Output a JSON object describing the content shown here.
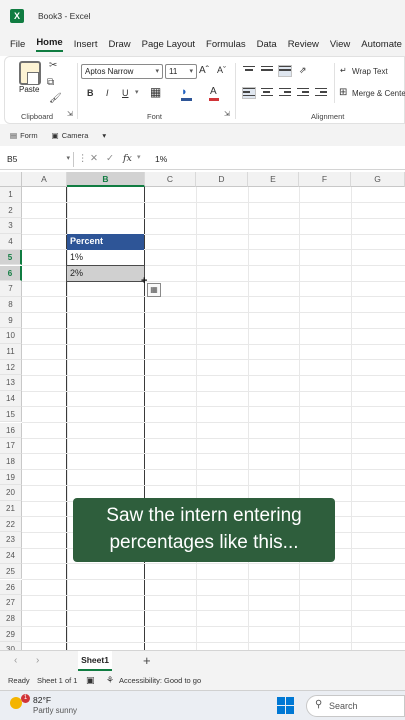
{
  "window": {
    "title": "Book3  -  Excel",
    "app_icon": "excel-logo-icon"
  },
  "menu": [
    "File",
    "Home",
    "Insert",
    "Draw",
    "Page Layout",
    "Formulas",
    "Data",
    "Review",
    "View",
    "Automate"
  ],
  "menu_active": "Home",
  "ribbon": {
    "clipboard": {
      "label": "Clipboard",
      "paste_label": "Paste"
    },
    "font": {
      "label": "Font",
      "family": "Aptos Narrow",
      "size": "11",
      "grow": "Aˆ",
      "shrink": "Aˇ",
      "bold": "B",
      "italic": "I",
      "underline": "U"
    },
    "alignment": {
      "label": "Alignment",
      "wrap_text": "Wrap Text",
      "merge_center": "Merge & Center"
    }
  },
  "qat": {
    "form": "Form",
    "camera": "Camera"
  },
  "formula_bar": {
    "name_box": "B5",
    "fx": "fx",
    "value": "1%"
  },
  "columns": [
    "A",
    "B",
    "C",
    "D",
    "E",
    "F",
    "G"
  ],
  "rows": [
    "1",
    "2",
    "3",
    "4",
    "5",
    "6",
    "7",
    "8",
    "9",
    "10",
    "11",
    "12",
    "13",
    "14",
    "15",
    "16",
    "17",
    "18",
    "19",
    "20",
    "21",
    "22",
    "23",
    "24",
    "25",
    "26",
    "27",
    "28",
    "29",
    "30"
  ],
  "cells": {
    "B4": "Percent",
    "B5": "1%",
    "B6": "2%"
  },
  "caption": {
    "line1": "Saw the intern entering",
    "line2": "percentages like this..."
  },
  "sheet_tabs": {
    "active": "Sheet1",
    "add": "+"
  },
  "status": {
    "mode": "Ready",
    "sheet_info": "Sheet 1 of 1",
    "accessibility": "Accessibility: Good to go"
  },
  "taskbar": {
    "weather_temp": "82°F",
    "weather_desc": "Partly sunny",
    "weather_badge": "1",
    "search": "Search"
  },
  "colors": {
    "accent": "#107c41",
    "header_fill": "#2e5597",
    "caption_bg": "#2e5e3c"
  }
}
